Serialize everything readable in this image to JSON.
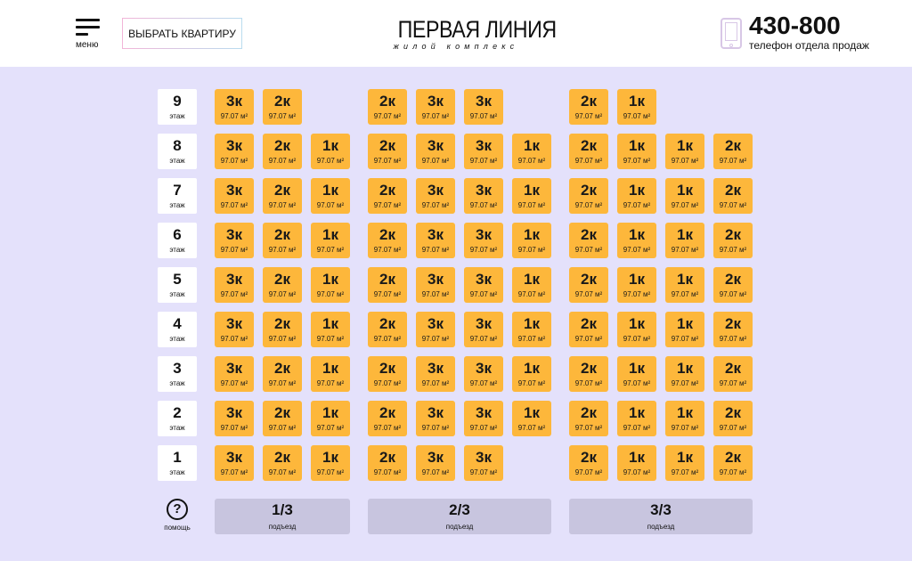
{
  "header": {
    "menu_label": "меню",
    "choose_button": "ВЫБРАТЬ КВАРТИРУ",
    "logo_title": "ПЕРВАЯ ЛИНИЯ",
    "logo_subtitle": "жилой комплекс",
    "phone": "430-800",
    "phone_caption": "телефон отдела продаж",
    "phone_icon": "smartphone-icon"
  },
  "colors": {
    "background": "#e4e1fb",
    "apartment": "#fdb73b",
    "entrance": "#c8c5df",
    "floor_label": "#ffffff"
  },
  "floor_word": "этаж",
  "area_text": "97.07 м²",
  "floors": [
    "9",
    "8",
    "7",
    "6",
    "5",
    "4",
    "3",
    "2",
    "1"
  ],
  "entrances": [
    {
      "label": "1/3",
      "caption": "подъезд",
      "rows": [
        [
          "3к",
          "2к"
        ],
        [
          "3к",
          "2к",
          "1к"
        ],
        [
          "3к",
          "2к",
          "1к"
        ],
        [
          "3к",
          "2к",
          "1к"
        ],
        [
          "3к",
          "2к",
          "1к"
        ],
        [
          "3к",
          "2к",
          "1к"
        ],
        [
          "3к",
          "2к",
          "1к"
        ],
        [
          "3к",
          "2к",
          "1к"
        ],
        [
          "3к",
          "2к",
          "1к"
        ]
      ]
    },
    {
      "label": "2/3",
      "caption": "подъезд",
      "rows": [
        [
          "2к",
          "3к",
          "3к"
        ],
        [
          "2к",
          "3к",
          "3к",
          "1к"
        ],
        [
          "2к",
          "3к",
          "3к",
          "1к"
        ],
        [
          "2к",
          "3к",
          "3к",
          "1к"
        ],
        [
          "2к",
          "3к",
          "3к",
          "1к"
        ],
        [
          "2к",
          "3к",
          "3к",
          "1к"
        ],
        [
          "2к",
          "3к",
          "3к",
          "1к"
        ],
        [
          "2к",
          "3к",
          "3к",
          "1к"
        ],
        [
          "2к",
          "3к",
          "3к"
        ]
      ]
    },
    {
      "label": "3/3",
      "caption": "подъезд",
      "rows": [
        [
          "2к",
          "1к"
        ],
        [
          "2к",
          "1к",
          "1к",
          "2к"
        ],
        [
          "2к",
          "1к",
          "1к",
          "2к"
        ],
        [
          "2к",
          "1к",
          "1к",
          "2к"
        ],
        [
          "2к",
          "1к",
          "1к",
          "2к"
        ],
        [
          "2к",
          "1к",
          "1к",
          "2к"
        ],
        [
          "2к",
          "1к",
          "1к",
          "2к"
        ],
        [
          "2к",
          "1к",
          "1к",
          "2к"
        ],
        [
          "2к",
          "1к",
          "1к",
          "2к"
        ]
      ]
    }
  ],
  "help": {
    "symbol": "?",
    "label": "помощь",
    "icon": "help-icon"
  }
}
